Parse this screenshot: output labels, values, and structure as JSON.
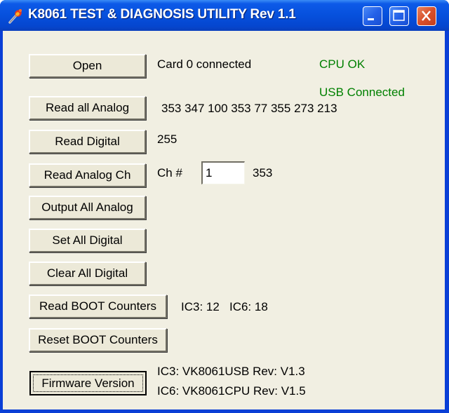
{
  "window": {
    "title": "K8061 TEST & DIAGNOSIS UTILITY Rev 1.1",
    "app_icon": "torch-icon",
    "controls": {
      "minimize": "minimize-icon",
      "maximize": "maximize-icon",
      "close": "close-icon"
    }
  },
  "buttons": {
    "open": "Open",
    "read_all_analog": "Read all Analog",
    "read_digital": "Read Digital",
    "read_analog_ch": "Read Analog Ch",
    "output_all_analog": "Output All Analog",
    "set_all_digital": "Set All Digital",
    "clear_all_digital": "Clear All Digital",
    "read_boot_counters": "Read BOOT Counters",
    "reset_boot_counters": "Reset BOOT Counters",
    "firmware_version": "Firmware Version"
  },
  "status": {
    "card": "Card 0 connected",
    "cpu": "CPU OK",
    "usb": "USB Connected",
    "status_color": "#008000"
  },
  "readings": {
    "all_analog": "353 347 100 353 77 355 273 213",
    "digital": "255",
    "channel_label": "Ch #",
    "channel_value": "1",
    "channel_reading": "353",
    "boot_counters": "IC3: 12   IC6: 18",
    "firmware_ic3": "IC3: VK8061USB Rev: V1.3",
    "firmware_ic6": "IC6: VK8061CPU Rev: V1.5"
  }
}
